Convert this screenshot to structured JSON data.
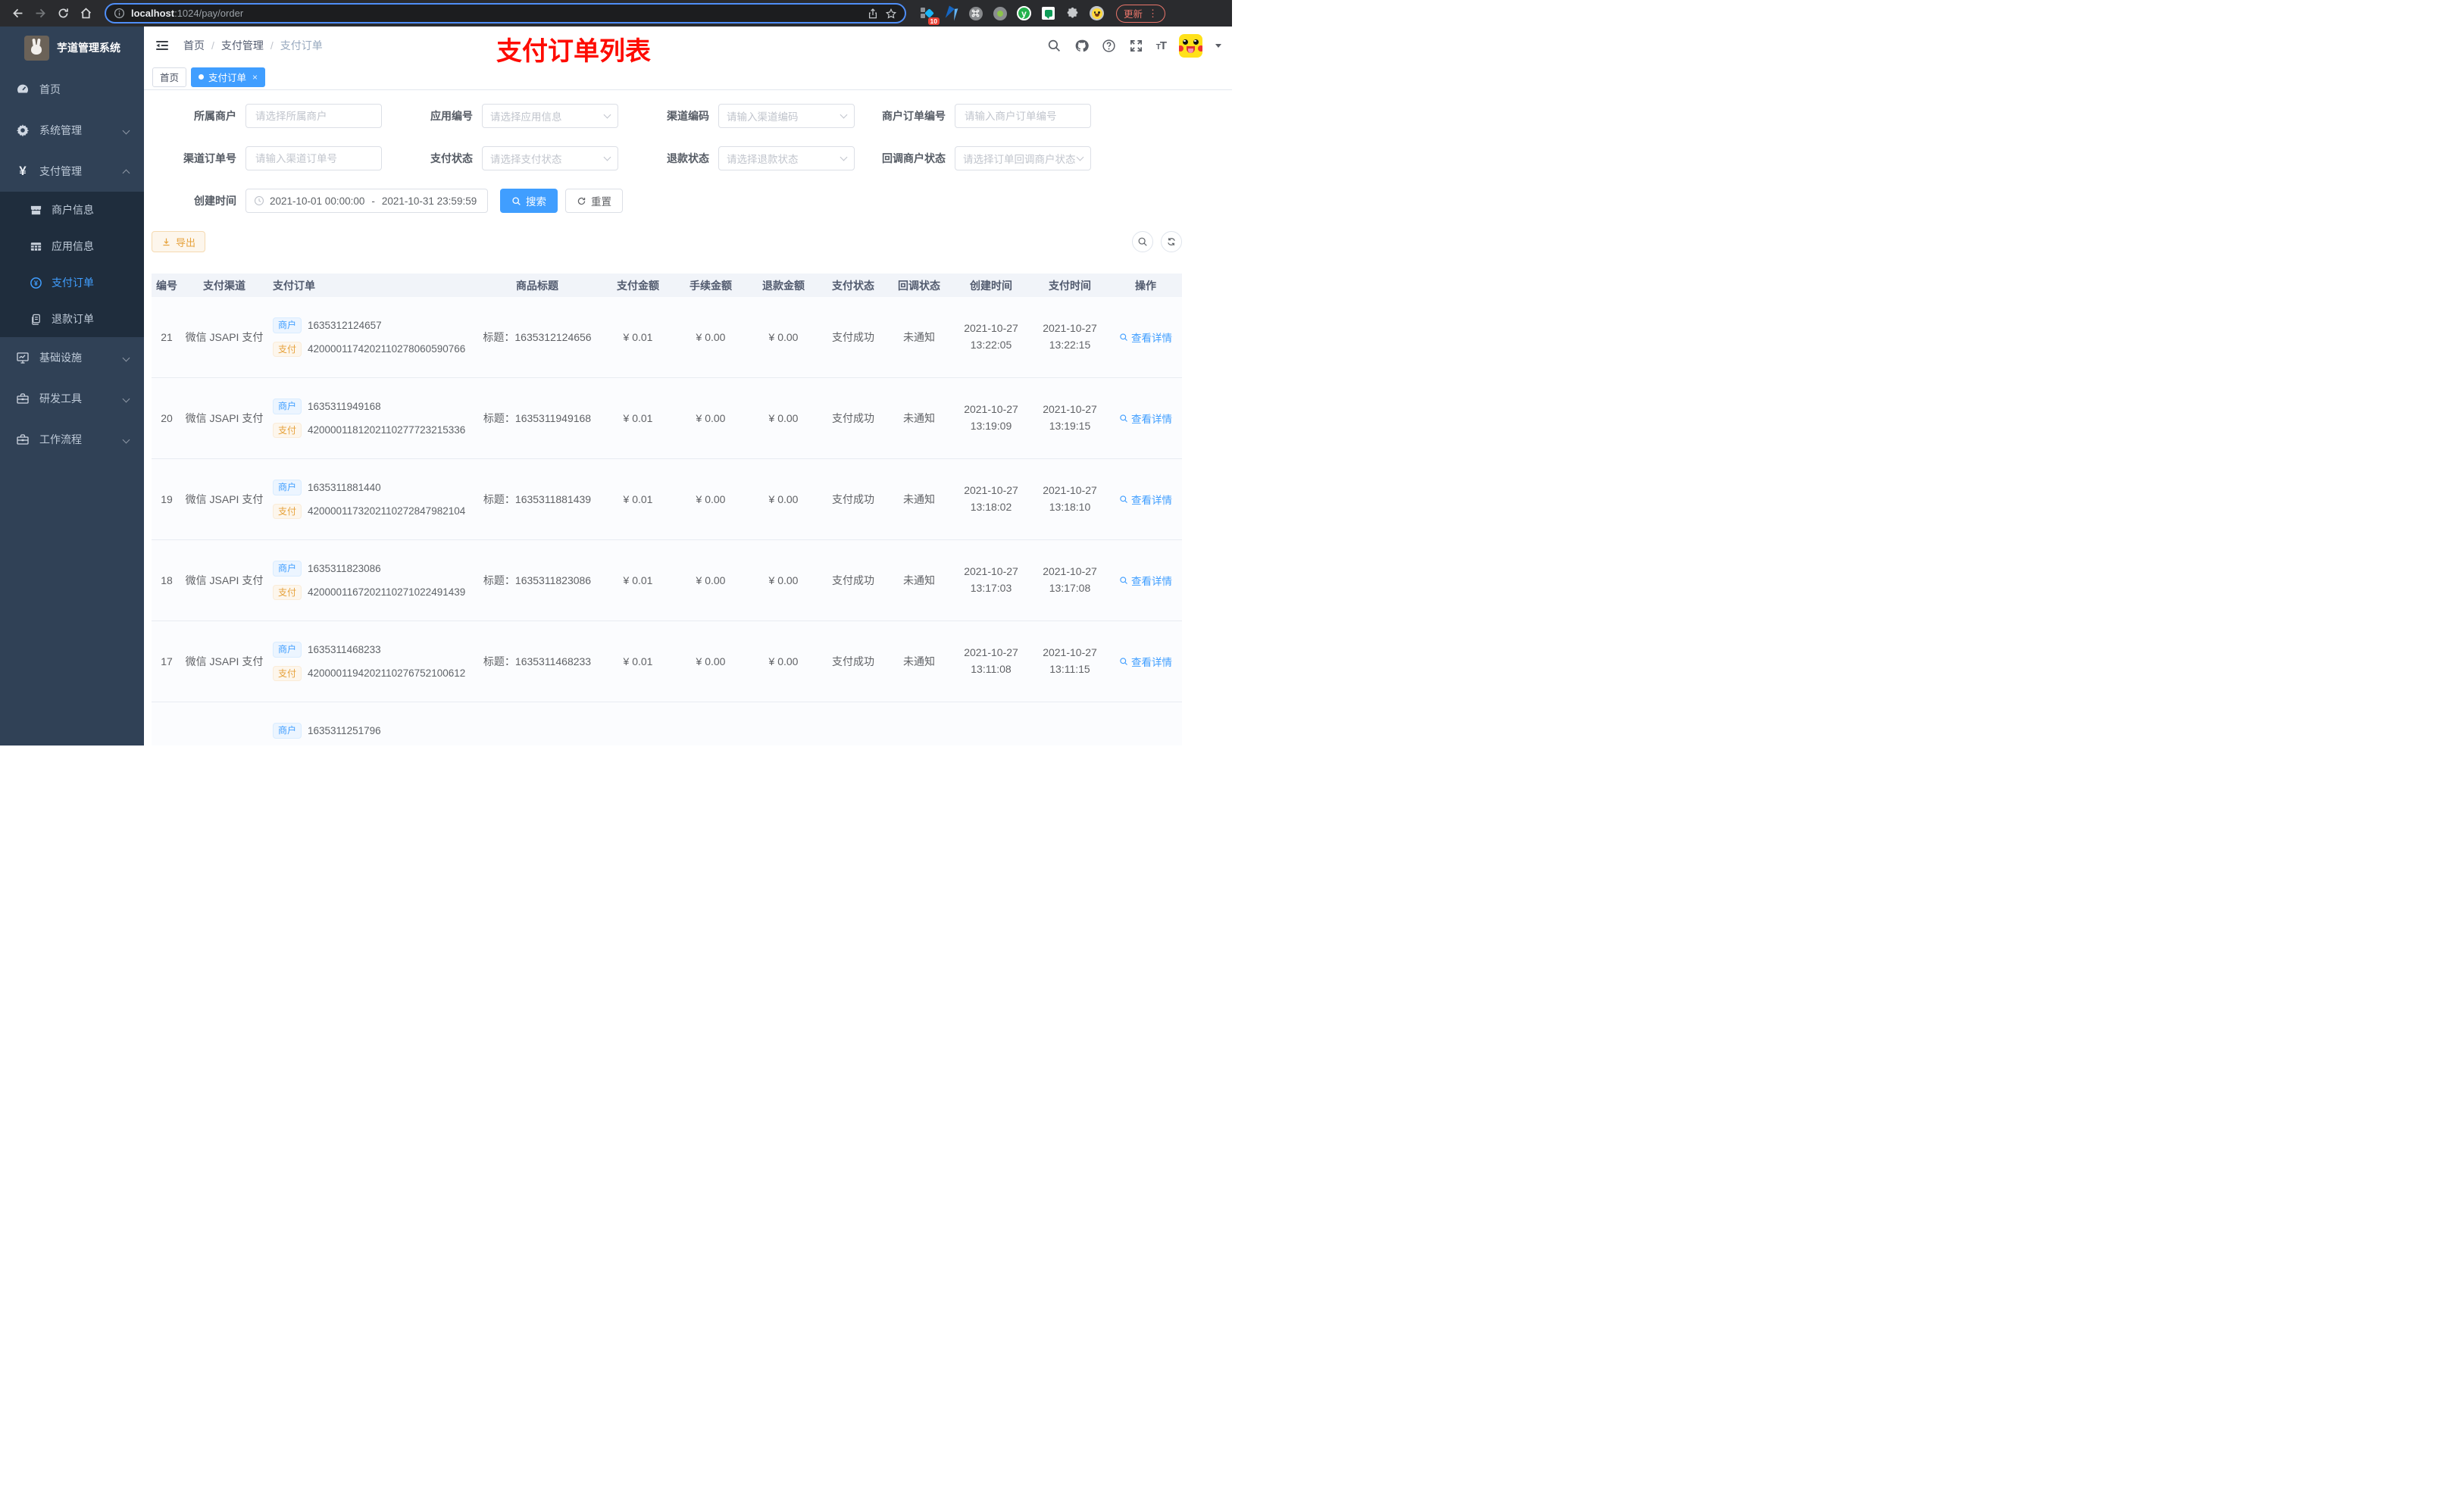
{
  "icons": {
    "close": "×",
    "more_vertical": "⋮",
    "yen": "¥"
  },
  "browser": {
    "url_host": "localhost",
    "url_path": ":1024/pay/order",
    "extension_badge": "10",
    "extension_y": "y",
    "update_button": "更新"
  },
  "sidebar": {
    "title": "芋道管理系统",
    "menu": [
      {
        "label": "首页"
      },
      {
        "label": "系统管理"
      },
      {
        "label": "支付管理"
      }
    ],
    "submenu": [
      {
        "label": "商户信息"
      },
      {
        "label": "应用信息"
      },
      {
        "label": "支付订单"
      },
      {
        "label": "退款订单"
      }
    ],
    "menu2": [
      {
        "label": "基础设施"
      },
      {
        "label": "研发工具"
      },
      {
        "label": "工作流程"
      }
    ]
  },
  "header": {
    "breadcrumb": [
      "首页",
      "支付管理",
      "支付订单"
    ],
    "breadcrumb_sep": "/",
    "annotation": "支付订单列表"
  },
  "tabs": [
    {
      "label": "首页"
    },
    {
      "label": "支付订单"
    }
  ],
  "filters": {
    "fields": [
      {
        "label": "所属商户",
        "placeholder": "请选择所属商户"
      },
      {
        "label": "应用编号",
        "placeholder": "请选择应用信息"
      },
      {
        "label": "渠道编码",
        "placeholder": "请输入渠道编码"
      },
      {
        "label": "商户订单编号",
        "placeholder": "请输入商户订单编号"
      },
      {
        "label": "渠道订单号",
        "placeholder": "请输入渠道订单号"
      },
      {
        "label": "支付状态",
        "placeholder": "请选择支付状态"
      },
      {
        "label": "退款状态",
        "placeholder": "请选择退款状态"
      },
      {
        "label": "回调商户状态",
        "placeholder": "请选择订单回调商户状态"
      }
    ],
    "date": {
      "label": "创建时间",
      "start": "2021-10-01 00:00:00",
      "sep": "-",
      "end": "2021-10-31 23:59:59"
    },
    "search_label": "搜索",
    "reset_label": "重置"
  },
  "toolbar": {
    "export_label": "导出"
  },
  "table": {
    "columns": [
      "编号",
      "支付渠道",
      "支付订单",
      "商品标题",
      "支付金额",
      "手续金额",
      "退款金额",
      "支付状态",
      "回调状态",
      "创建时间",
      "支付时间",
      "操作"
    ],
    "tag_merchant": "商户",
    "tag_pay": "支付",
    "action_label": "查看详情",
    "rows": [
      {
        "id": "21",
        "channel": "微信 JSAPI 支付",
        "mch_no": "1635312124657",
        "pay_no": "4200001174202110278060590766",
        "title": "标题：1635312124656",
        "amount": "¥ 0.01",
        "fee": "¥ 0.00",
        "refund": "¥ 0.00",
        "status": "支付成功",
        "notify": "未通知",
        "created_d": "2021-10-27",
        "created_t": "13:22:05",
        "paid_d": "2021-10-27",
        "paid_t": "13:22:15",
        "action": true
      },
      {
        "id": "20",
        "channel": "微信 JSAPI 支付",
        "mch_no": "1635311949168",
        "pay_no": "4200001181202110277723215336",
        "title": "标题：1635311949168",
        "amount": "¥ 0.01",
        "fee": "¥ 0.00",
        "refund": "¥ 0.00",
        "status": "支付成功",
        "notify": "未通知",
        "created_d": "2021-10-27",
        "created_t": "13:19:09",
        "paid_d": "2021-10-27",
        "paid_t": "13:19:15",
        "action": true
      },
      {
        "id": "19",
        "channel": "微信 JSAPI 支付",
        "mch_no": "1635311881440",
        "pay_no": "4200001173202110272847982104",
        "title": "标题：1635311881439",
        "amount": "¥ 0.01",
        "fee": "¥ 0.00",
        "refund": "¥ 0.00",
        "status": "支付成功",
        "notify": "未通知",
        "created_d": "2021-10-27",
        "created_t": "13:18:02",
        "paid_d": "2021-10-27",
        "paid_t": "13:18:10",
        "action": true
      },
      {
        "id": "18",
        "channel": "微信 JSAPI 支付",
        "mch_no": "1635311823086",
        "pay_no": "4200001167202110271022491439",
        "title": "标题：1635311823086",
        "amount": "¥ 0.01",
        "fee": "¥ 0.00",
        "refund": "¥ 0.00",
        "status": "支付成功",
        "notify": "未通知",
        "created_d": "2021-10-27",
        "created_t": "13:17:03",
        "paid_d": "2021-10-27",
        "paid_t": "13:17:08",
        "action": true
      },
      {
        "id": "17",
        "channel": "微信 JSAPI 支付",
        "mch_no": "1635311468233",
        "pay_no": "4200001194202110276752100612",
        "title": "标题：1635311468233",
        "amount": "¥ 0.01",
        "fee": "¥ 0.00",
        "refund": "¥ 0.00",
        "status": "支付成功",
        "notify": "未通知",
        "created_d": "2021-10-27",
        "created_t": "13:11:08",
        "paid_d": "2021-10-27",
        "paid_t": "13:11:15",
        "action": true
      },
      {
        "id": "",
        "channel": "",
        "mch_no": "1635311251796",
        "pay_no": "",
        "title": "",
        "amount": "",
        "fee": "",
        "refund": "",
        "status": "",
        "notify": "",
        "created_d": "",
        "created_t": "",
        "paid_d": "",
        "paid_t": "",
        "action": false
      }
    ]
  }
}
